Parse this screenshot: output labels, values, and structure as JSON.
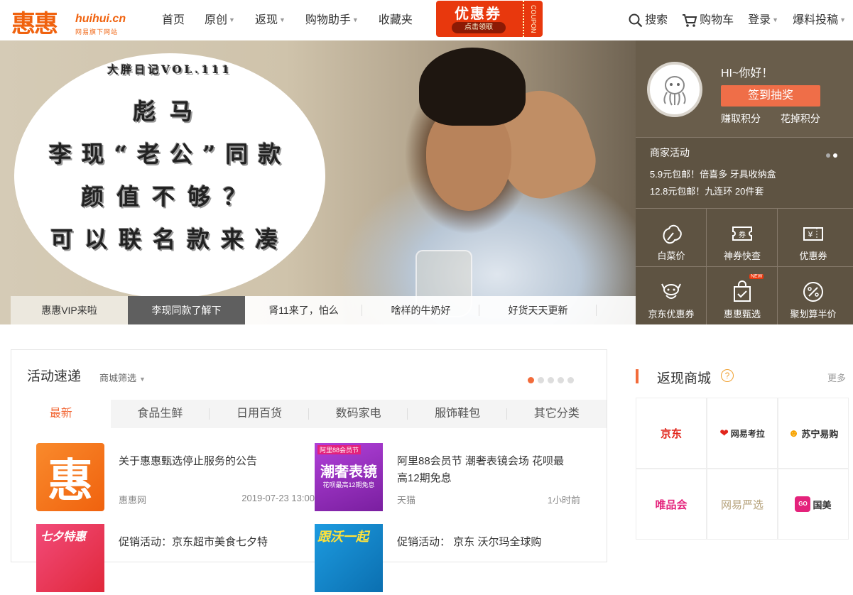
{
  "header": {
    "logo_big": "惠惠",
    "logo_en": "huihui.cn",
    "logo_sub": "网易旗下网站",
    "nav": [
      {
        "label": "首页",
        "caret": false
      },
      {
        "label": "原创",
        "caret": true
      },
      {
        "label": "返现",
        "caret": true
      },
      {
        "label": "购物助手",
        "caret": true
      },
      {
        "label": "收藏夹",
        "caret": false
      }
    ],
    "coupon_title": "优惠券",
    "coupon_sub": "点击领取",
    "coupon_side": "COUPON",
    "search": "搜索",
    "cart": "购物车",
    "login": "登录",
    "submit": "爆料投稿"
  },
  "banner": {
    "line1": "大胖日记VOL.111",
    "line2": "彪马",
    "line3": "李现“老公”同款",
    "line4": "颜值不够？",
    "line5": "可以联名款来凑",
    "tabs": [
      "惠惠VIP来啦",
      "李现同款了解下",
      "肾11来了，怕么",
      "啥样的牛奶好",
      "好货天天更新"
    ]
  },
  "user": {
    "hi": "HI~你好！",
    "sign": "签到抽奖",
    "earn": "赚取积分",
    "spend": "花掉积分"
  },
  "merchant": {
    "title": "商家活动",
    "line1": "5.9元包邮！倍喜多 牙具收纳盒",
    "line2": "12.8元包邮！九连环 20件套"
  },
  "quick": {
    "items": [
      "白菜价",
      "神券快查",
      "优惠券",
      "京东优惠券",
      "惠惠甄选",
      "聚划算半价"
    ],
    "new_tag": "NEW"
  },
  "activity": {
    "title": "活动速递",
    "filter": "商城筛选",
    "categories": [
      "最新",
      "食品生鲜",
      "日用百货",
      "数码家电",
      "服饰鞋包",
      "其它分类"
    ],
    "posts": [
      {
        "title": "关于惠惠甄选停止服务的公告",
        "source": "惠惠网",
        "time": "2019-07-23 13:00:00",
        "thumb_text": "惠"
      },
      {
        "title": "阿里88会员节 潮奢表镜会场 花呗最高12期免息",
        "source": "天猫",
        "time": "1小时前",
        "thumb_text": "潮奢表镜",
        "thumb_top": "阿里88会员节",
        "thumb_sub": "花呗最高12期免息"
      },
      {
        "title": "促销活动：京东超市美食七夕特",
        "source": "",
        "time": "",
        "thumb_text": "七夕特惠"
      },
      {
        "title": "促销活动： 京东 沃尔玛全球购",
        "source": "",
        "time": "",
        "thumb_text": "跟沃一起"
      }
    ]
  },
  "shops": {
    "title": "返现商城",
    "help": "?",
    "more": "更多",
    "items": [
      {
        "name": "京东",
        "color": "#e1251b"
      },
      {
        "name": "网易考拉",
        "color": "#333333"
      },
      {
        "name": "苏宁易购",
        "color": "#333333"
      },
      {
        "name": "唯品会",
        "color": "#e4227b"
      },
      {
        "name": "网易严选",
        "color": "#b4a078"
      },
      {
        "name": "国美",
        "color": "#333333"
      }
    ]
  }
}
